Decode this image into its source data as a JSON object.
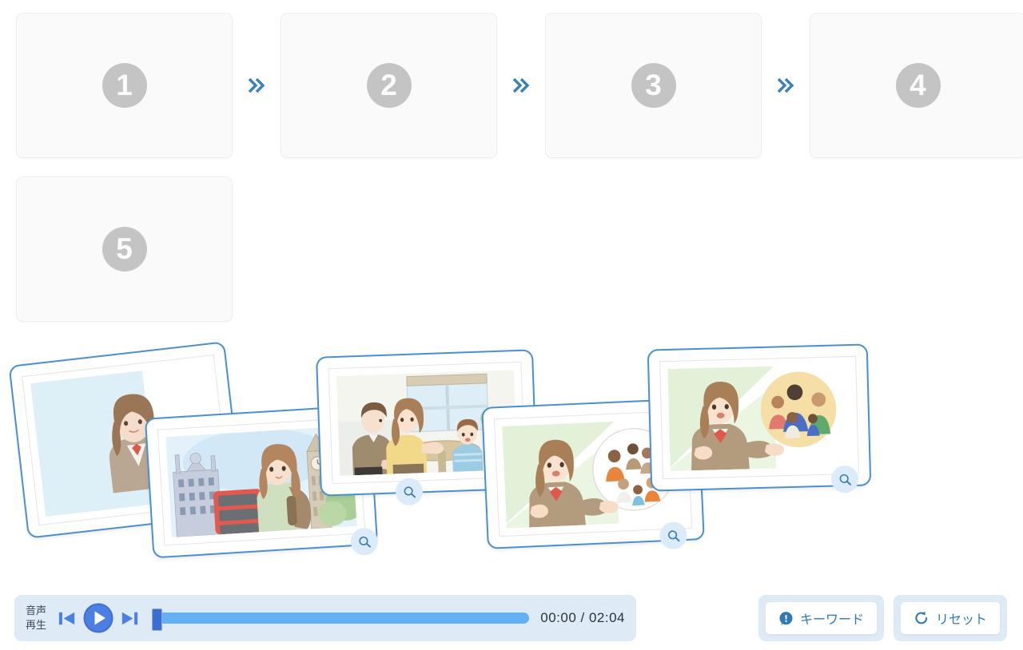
{
  "slots": {
    "items": [
      {
        "number": "1",
        "name": "drop-slot-1"
      },
      {
        "number": "2",
        "name": "drop-slot-2"
      },
      {
        "number": "3",
        "name": "drop-slot-3"
      },
      {
        "number": "4",
        "name": "drop-slot-4"
      },
      {
        "number": "5",
        "name": "drop-slot-5"
      }
    ],
    "separator_icon": "double-chevron-right-icon",
    "badge_color": "#c4c4c4",
    "chevron_color": "#3b81b8",
    "slot_bg": "#fafafa"
  },
  "cards": {
    "zoom_icon": "magnifier-icon",
    "border_color": "#4a90cf",
    "items": [
      {
        "name": "photo-card-1",
        "scene": "girl-in-blazer-portrait",
        "has_zoom": false
      },
      {
        "name": "photo-card-2",
        "scene": "girl-with-backpack-london-big-ben",
        "has_zoom": true
      },
      {
        "name": "photo-card-3",
        "scene": "family-at-cafe-table",
        "has_zoom": true
      },
      {
        "name": "photo-card-4",
        "scene": "girl-presenting-people-bubble",
        "has_zoom": true
      },
      {
        "name": "photo-card-5",
        "scene": "girl-presenting-family-bubble",
        "has_zoom": true
      }
    ]
  },
  "audio": {
    "label_line1": "音声",
    "label_line2": "再生",
    "prev_icon": "skip-previous-icon",
    "play_icon": "play-circle-icon",
    "next_icon": "skip-next-icon",
    "current_time": "00:00",
    "total_time": "02:04",
    "time_display": "00:00 / 02:04",
    "progress_percent": 0,
    "panel_color": "#dfeaf7",
    "track_color": "#63b0f5",
    "handle_color": "#3a6fd0"
  },
  "actions": {
    "keyword": {
      "label": "キーワード",
      "icon": "exclamation-bubble-icon"
    },
    "reset": {
      "label": "リセット",
      "icon": "refresh-icon"
    },
    "text_color": "#2f79b5"
  }
}
